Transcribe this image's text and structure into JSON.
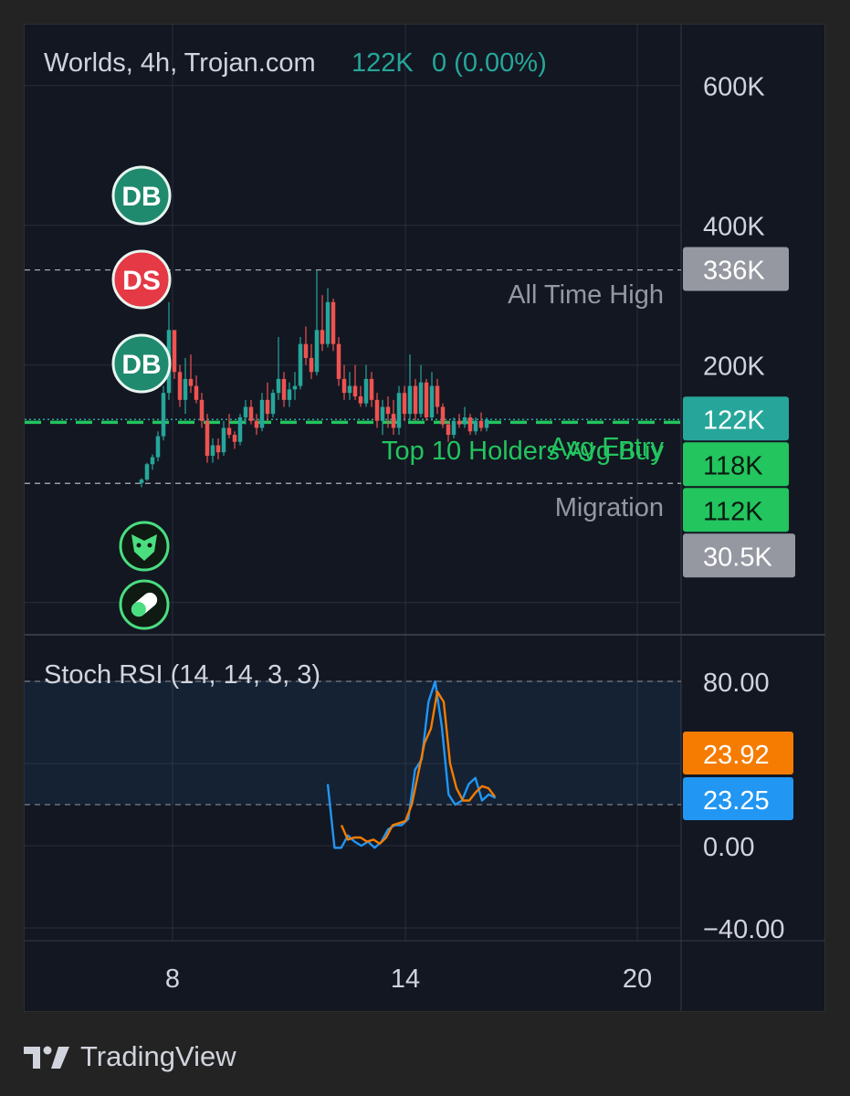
{
  "legend": {
    "title": "Worlds, 4h, Trojan.com",
    "price": "122K",
    "change": "0 (0.00%)"
  },
  "price_axis": {
    "ticks": [
      {
        "label": "600K",
        "value": 600000
      },
      {
        "label": "400K",
        "value": 400000
      },
      {
        "label": "200K",
        "value": 200000
      }
    ],
    "tags": [
      {
        "label": "336K",
        "value": 336000,
        "bg": "#9598a1",
        "fg": "#ffffff"
      },
      {
        "label": "122K",
        "value": 122000,
        "bg": "#26a69a",
        "fg": "#ffffff"
      },
      {
        "label": "118K",
        "value": 118000,
        "bg": "#22c55e",
        "fg": "#0b1a10"
      },
      {
        "label": "112K",
        "value": 112000,
        "bg": "#22c55e",
        "fg": "#0b1a10"
      },
      {
        "label": "30.5K",
        "value": 30500,
        "bg": "#9598a1",
        "fg": "#ffffff"
      }
    ]
  },
  "price_lines": [
    {
      "label": "All Time High",
      "color": "#9598a1"
    },
    {
      "label": "Avg Entry",
      "color": "#22c55e"
    },
    {
      "label": "Top 10 Holders Avg Buy",
      "color": "#22c55e"
    },
    {
      "label": "Migration",
      "color": "#9598a1"
    }
  ],
  "markers": [
    {
      "text": "DB",
      "kind": "buy"
    },
    {
      "text": "DS",
      "kind": "sell"
    },
    {
      "text": "DB",
      "kind": "buy"
    },
    {
      "icon": "eagle-icon"
    },
    {
      "icon": "pill-icon"
    }
  ],
  "indicator": {
    "title": "Stoch RSI (14, 14, 3, 3)",
    "ticks": [
      {
        "label": "80.00",
        "value": 80
      },
      {
        "label": "0.00",
        "value": 0
      },
      {
        "label": "−40.00",
        "value": -40
      }
    ],
    "tags": [
      {
        "label": "23.92",
        "value": 23.92,
        "bg": "#f57c00"
      },
      {
        "label": "23.25",
        "value": 23.25,
        "bg": "#2196f3"
      }
    ]
  },
  "time_axis": [
    "8",
    "14",
    "20"
  ],
  "brand": "TradingView",
  "colors": {
    "up": "#26a69a",
    "down": "#ef5350",
    "k_line": "#2196f3",
    "d_line": "#f57c00",
    "grid": "#2a2e39",
    "text": "#d1d4dc"
  },
  "chart_data": [
    {
      "type": "candlestick",
      "title": "Worlds, 4h, Trojan.com",
      "x_ticks": [
        "8",
        "14",
        "20"
      ],
      "ylim": [
        0,
        650000
      ],
      "last": 122000,
      "price_lines": [
        {
          "label": "All Time High",
          "value": 336000
        },
        {
          "label": "Avg Entry",
          "value": 118000
        },
        {
          "label": "Top 10 Holders Avg Buy",
          "value": 118000
        },
        {
          "label": "Migration",
          "value": 30500
        }
      ],
      "candles": [
        [
          31,
          38,
          25,
          36
        ],
        [
          36,
          60,
          34,
          58
        ],
        [
          58,
          72,
          50,
          68
        ],
        [
          68,
          105,
          62,
          98
        ],
        [
          98,
          170,
          92,
          160
        ],
        [
          160,
          290,
          150,
          250
        ],
        [
          250,
          248,
          180,
          190
        ],
        [
          190,
          200,
          140,
          150
        ],
        [
          150,
          210,
          130,
          180
        ],
        [
          180,
          215,
          160,
          170
        ],
        [
          170,
          185,
          145,
          150
        ],
        [
          150,
          160,
          110,
          120
        ],
        [
          120,
          130,
          60,
          70
        ],
        [
          70,
          95,
          60,
          85
        ],
        [
          85,
          95,
          65,
          75
        ],
        [
          75,
          120,
          70,
          110
        ],
        [
          110,
          130,
          95,
          100
        ],
        [
          100,
          105,
          80,
          90
        ],
        [
          90,
          130,
          85,
          125
        ],
        [
          125,
          150,
          115,
          140
        ],
        [
          140,
          150,
          115,
          120
        ],
        [
          120,
          130,
          100,
          110
        ],
        [
          110,
          160,
          105,
          150
        ],
        [
          150,
          175,
          120,
          130
        ],
        [
          130,
          165,
          125,
          160
        ],
        [
          160,
          240,
          150,
          180
        ],
        [
          180,
          190,
          140,
          150
        ],
        [
          150,
          175,
          140,
          165
        ],
        [
          165,
          190,
          150,
          170
        ],
        [
          170,
          240,
          165,
          230
        ],
        [
          230,
          255,
          200,
          210
        ],
        [
          210,
          230,
          180,
          190
        ],
        [
          190,
          336,
          185,
          250
        ],
        [
          250,
          300,
          220,
          230
        ],
        [
          230,
          310,
          225,
          290
        ],
        [
          290,
          295,
          220,
          230
        ],
        [
          230,
          240,
          170,
          180
        ],
        [
          180,
          200,
          150,
          160
        ],
        [
          160,
          190,
          150,
          170
        ],
        [
          170,
          200,
          150,
          155
        ],
        [
          155,
          170,
          140,
          145
        ],
        [
          145,
          200,
          140,
          180
        ],
        [
          180,
          190,
          140,
          150
        ],
        [
          150,
          160,
          110,
          120
        ],
        [
          120,
          150,
          100,
          140
        ],
        [
          140,
          155,
          110,
          130
        ],
        [
          130,
          150,
          100,
          110
        ],
        [
          110,
          170,
          100,
          160
        ],
        [
          160,
          170,
          120,
          130
        ],
        [
          130,
          215,
          120,
          170
        ],
        [
          170,
          180,
          120,
          130
        ],
        [
          130,
          200,
          125,
          175
        ],
        [
          175,
          180,
          120,
          125
        ],
        [
          125,
          190,
          120,
          170
        ],
        [
          170,
          180,
          130,
          140
        ],
        [
          140,
          145,
          110,
          115
        ],
        [
          115,
          120,
          90,
          100
        ],
        [
          100,
          125,
          95,
          120
        ],
        [
          120,
          130,
          110,
          115
        ],
        [
          115,
          140,
          110,
          125
        ],
        [
          125,
          130,
          100,
          105
        ],
        [
          105,
          125,
          100,
          120
        ],
        [
          120,
          132,
          105,
          110
        ],
        [
          110,
          125,
          105,
          122
        ]
      ]
    },
    {
      "type": "line",
      "title": "Stoch RSI (14, 14, 3, 3)",
      "ylim": [
        -40,
        80
      ],
      "band": [
        20,
        80
      ],
      "series": [
        {
          "name": "K",
          "values": [
            30,
            -1,
            -1,
            5,
            2,
            0,
            2,
            -1,
            2,
            8,
            10,
            10,
            13,
            37,
            42,
            70,
            80,
            58,
            25,
            20,
            22,
            30,
            33,
            22,
            25,
            23.25
          ]
        },
        {
          "name": "D",
          "values": [
            10,
            3,
            4,
            4,
            2,
            3,
            1,
            4,
            10,
            11,
            12,
            20,
            35,
            50,
            57,
            75,
            70,
            40,
            28,
            22,
            22,
            26,
            29,
            28,
            23.92
          ]
        }
      ]
    }
  ]
}
